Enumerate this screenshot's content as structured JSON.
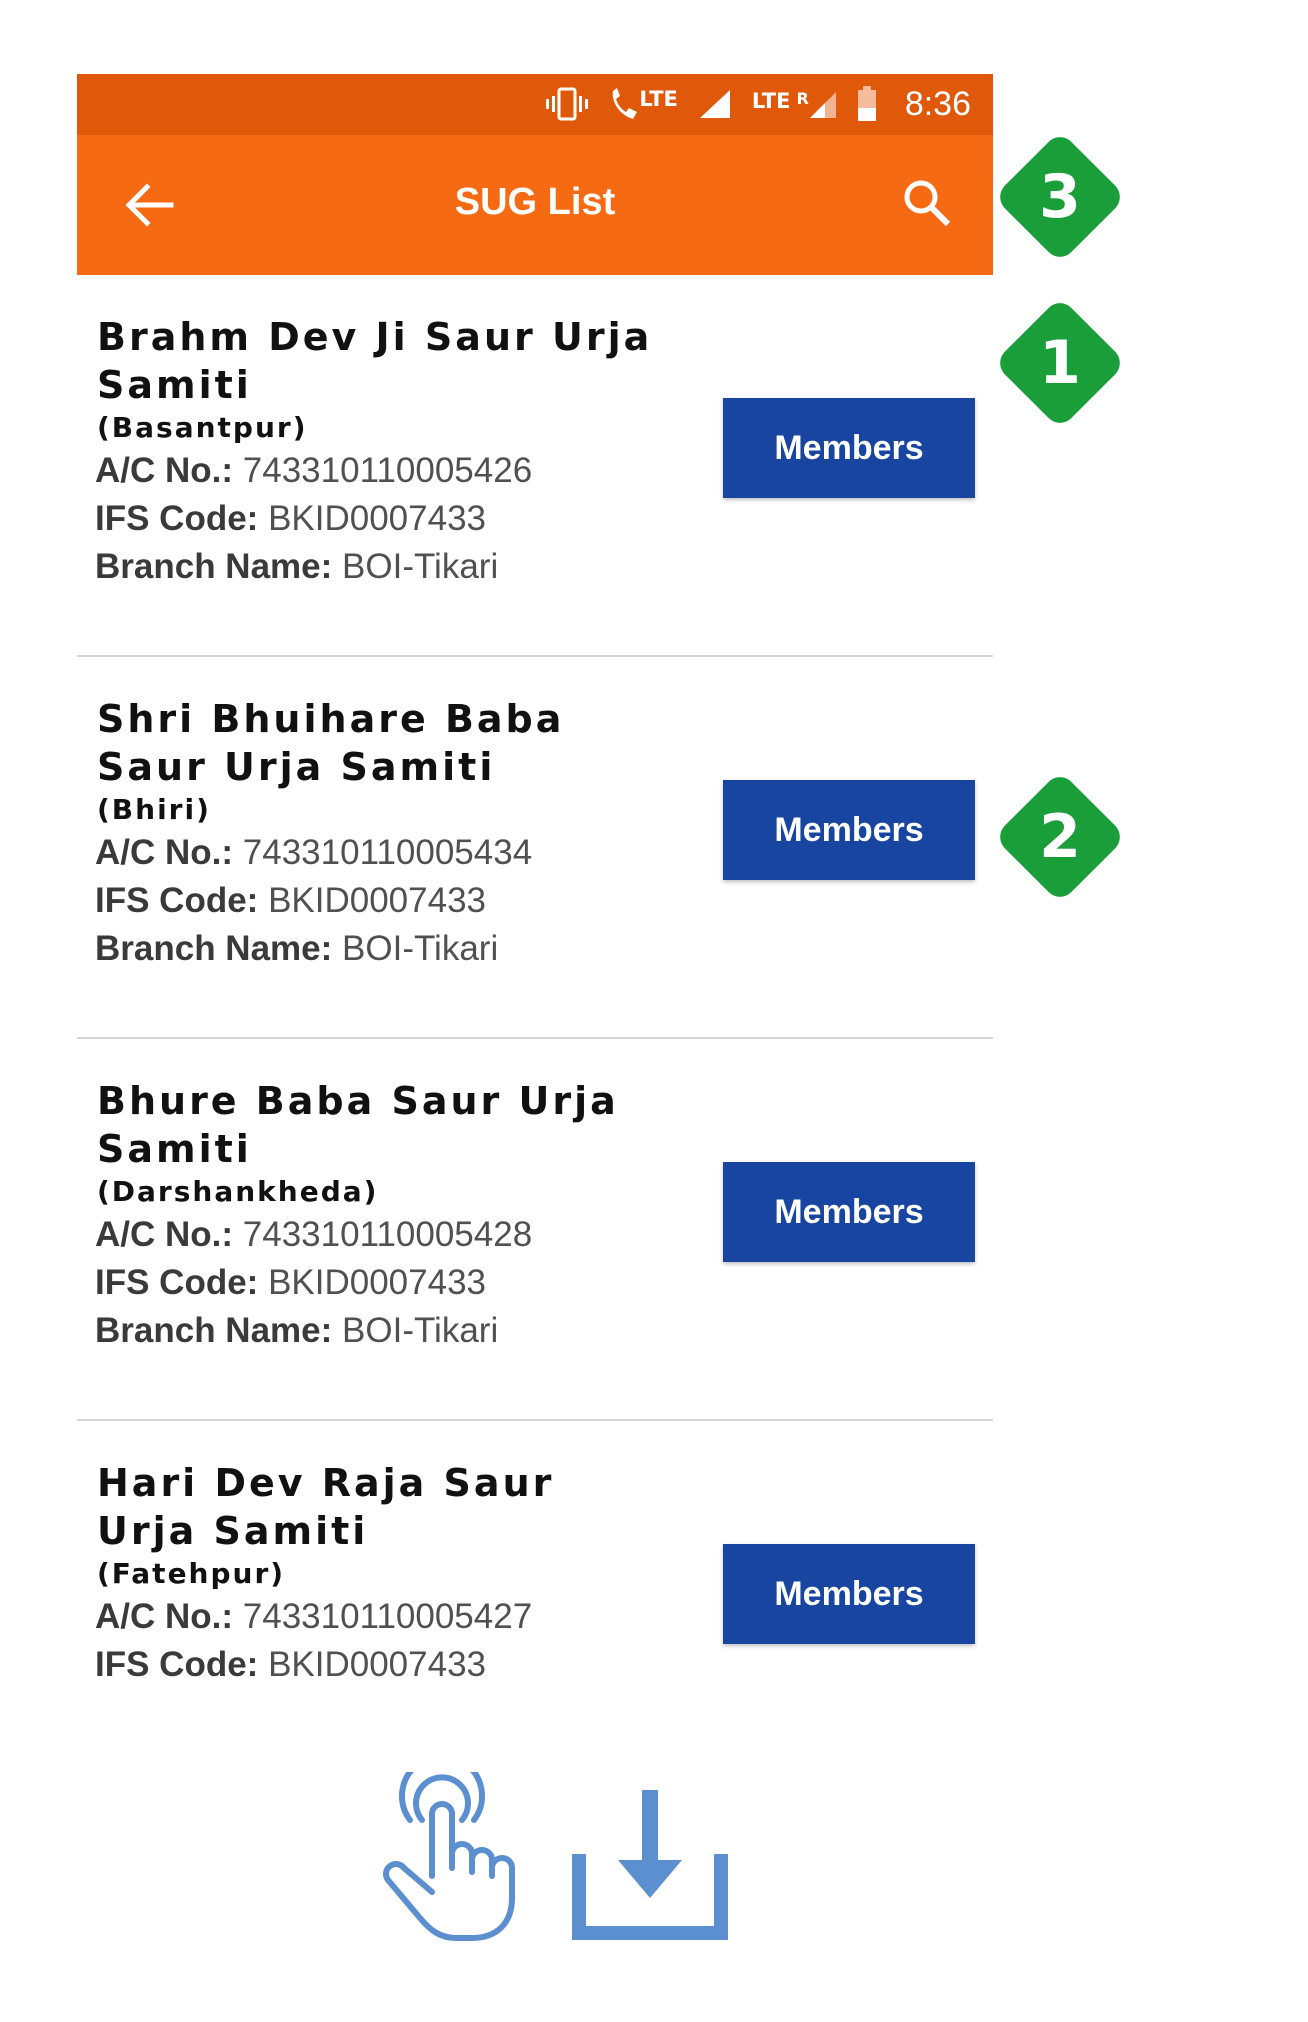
{
  "status_bar": {
    "network1": "LTE",
    "network2": "LTE",
    "roaming": "R",
    "time": "8:36",
    "icons": [
      "vibrate-icon",
      "volte-call-icon",
      "signal-icon",
      "signal-roaming-icon",
      "battery-icon"
    ]
  },
  "app_bar": {
    "title": "SUG List",
    "back_icon": "arrow-left-icon",
    "search_icon": "search-icon"
  },
  "labels": {
    "ac_no": "A/C No.:",
    "ifs_code": "IFS Code:",
    "branch_name": "Branch Name:",
    "members": "Members"
  },
  "groups": [
    {
      "name": "Brahm Dev Ji Saur Urja Samiti",
      "village": "(Basantpur)",
      "ac_no": "743310110005426",
      "ifs": "BKID0007433",
      "branch": "BOI-Tikari"
    },
    {
      "name": "Shri Bhuihare Baba Saur Urja Samiti",
      "village": "(Bhiri)",
      "ac_no": "743310110005434",
      "ifs": "BKID0007433",
      "branch": "BOI-Tikari"
    },
    {
      "name": "Bhure Baba Saur Urja Samiti",
      "village": "(Darshankheda)",
      "ac_no": "743310110005428",
      "ifs": "BKID0007433",
      "branch": "BOI-Tikari"
    },
    {
      "name": "Hari Dev Raja Saur Urja Samiti",
      "village": "(Fatehpur)",
      "ac_no": "743310110005427",
      "ifs": "BKID0007433"
    }
  ],
  "callouts": [
    "1",
    "2",
    "3"
  ],
  "colors": {
    "status_bar": "#e0580a",
    "app_bar": "#f76a14",
    "button": "#1845a0",
    "badge": "#1a9e3a",
    "bottom_icons": "#5b8fcf"
  },
  "bottom_icons": [
    "touch-icon",
    "download-icon"
  ]
}
